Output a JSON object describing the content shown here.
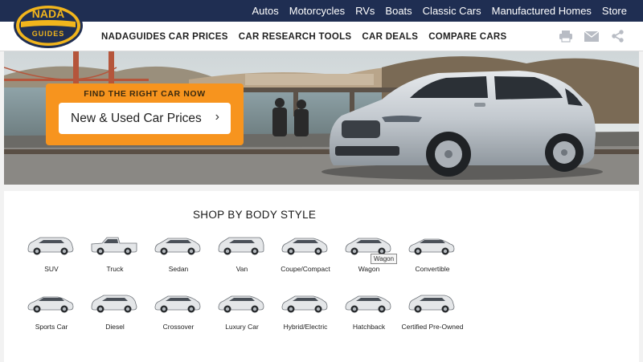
{
  "topnav": [
    "Autos",
    "Motorcycles",
    "RVs",
    "Boats",
    "Classic Cars",
    "Manufactured Homes",
    "Store"
  ],
  "logo": {
    "line1": "NADA",
    "line2": "GUIDES",
    "colors": {
      "navy": "#1f2e52",
      "gold": "#f1b51c"
    }
  },
  "subnav": [
    "NADAGUIDES CAR PRICES",
    "CAR RESEARCH TOOLS",
    "CAR DEALS",
    "COMPARE CARS"
  ],
  "tools": [
    "print-icon",
    "email-icon",
    "share-icon"
  ],
  "hero": {
    "cta_title": "FIND THE RIGHT CAR NOW",
    "cta_button": "New & Used Car Prices",
    "cta_chevron": "›",
    "accent": "#f7941e"
  },
  "shop": {
    "title": "SHOP BY BODY STYLE",
    "row1": [
      "SUV",
      "Truck",
      "Sedan",
      "Van",
      "Coupe/Compact",
      "Wagon",
      "Convertible"
    ],
    "row2": [
      "Sports Car",
      "Diesel",
      "Crossover",
      "Luxury Car",
      "Hybrid/Electric",
      "Hatchback",
      "Certified Pre-Owned"
    ],
    "tooltip": "Wagon"
  }
}
